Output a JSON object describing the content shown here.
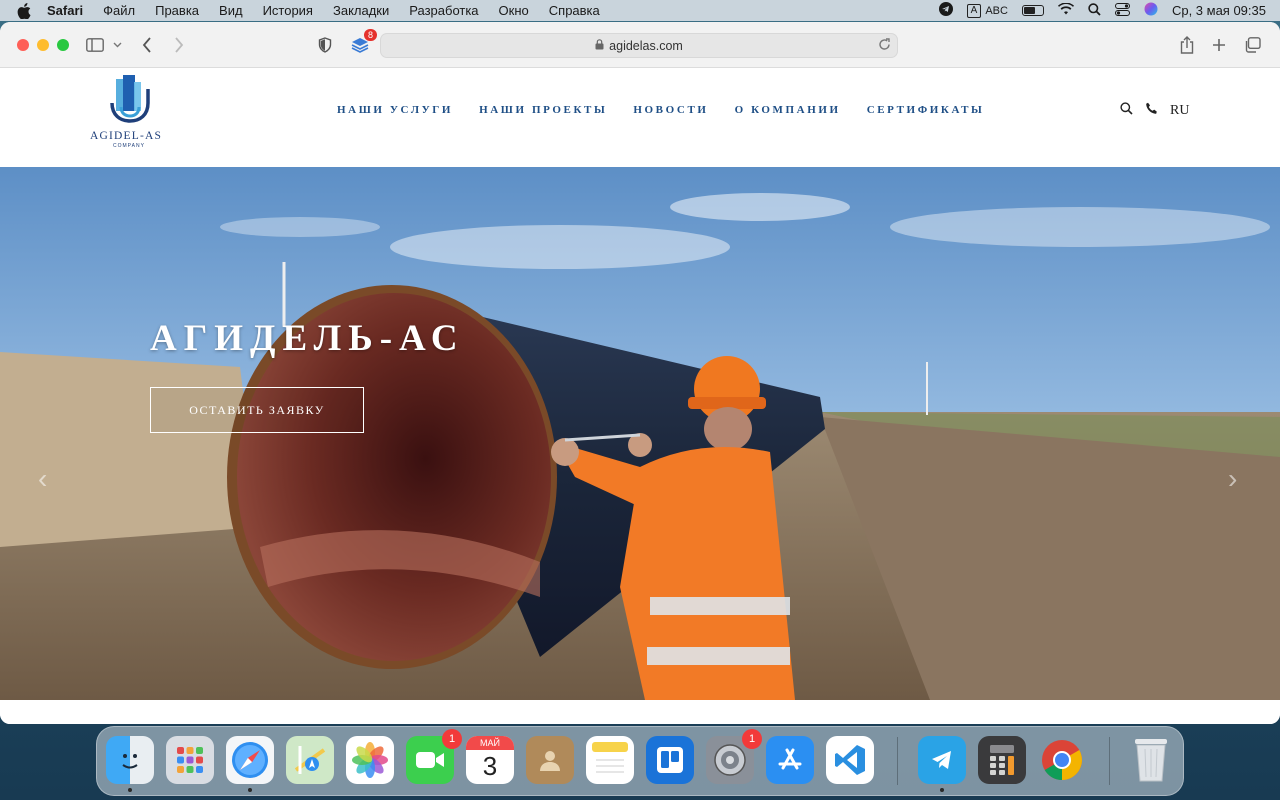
{
  "menubar": {
    "app": "Safari",
    "items": [
      "Файл",
      "Правка",
      "Вид",
      "История",
      "Закладки",
      "Разработка",
      "Окно",
      "Справка"
    ],
    "input_source": "ABC",
    "input_letter": "A",
    "datetime": "Ср, 3 мая  09:35"
  },
  "browser": {
    "url": "agidelas.com",
    "extension_badge": "8"
  },
  "site": {
    "logo_text": "AGIDEL-AS",
    "logo_sub": "COMPANY",
    "nav": [
      "НАШИ УСЛУГИ",
      "НАШИ ПРОЕКТЫ",
      "НОВОСТИ",
      "О КОМПАНИИ",
      "СЕРТИФИКАТЫ"
    ],
    "lang": "RU",
    "hero_title": "АГИДЕЛЬ-АС",
    "hero_button": "ОСТАВИТЬ ЗАЯВКУ",
    "colors": {
      "nav": "#1f4f86",
      "logo": "#1f3f7a"
    }
  },
  "dock": {
    "apps": [
      {
        "name": "Finder",
        "icon": "finder-icon"
      },
      {
        "name": "Launchpad",
        "icon": "launchpad-icon"
      },
      {
        "name": "Safari",
        "icon": "safari-icon"
      },
      {
        "name": "Maps",
        "icon": "maps-icon"
      },
      {
        "name": "Photos",
        "icon": "photos-icon"
      },
      {
        "name": "FaceTime",
        "icon": "facetime-icon",
        "badge": "1"
      },
      {
        "name": "Calendar",
        "icon": "calendar-icon",
        "month": "МАЙ",
        "day": "3"
      },
      {
        "name": "Contacts",
        "icon": "contacts-icon"
      },
      {
        "name": "Notes",
        "icon": "notes-icon"
      },
      {
        "name": "Trello",
        "icon": "trello-icon"
      },
      {
        "name": "System Settings",
        "icon": "settings-icon",
        "badge": "1"
      },
      {
        "name": "App Store",
        "icon": "appstore-icon"
      },
      {
        "name": "VS Code",
        "icon": "vscode-icon"
      },
      {
        "name": "Telegram",
        "icon": "telegram-icon"
      },
      {
        "name": "Calculator",
        "icon": "calculator-icon"
      },
      {
        "name": "Chrome",
        "icon": "chrome-icon"
      },
      {
        "name": "Trash",
        "icon": "trash-icon"
      }
    ]
  }
}
